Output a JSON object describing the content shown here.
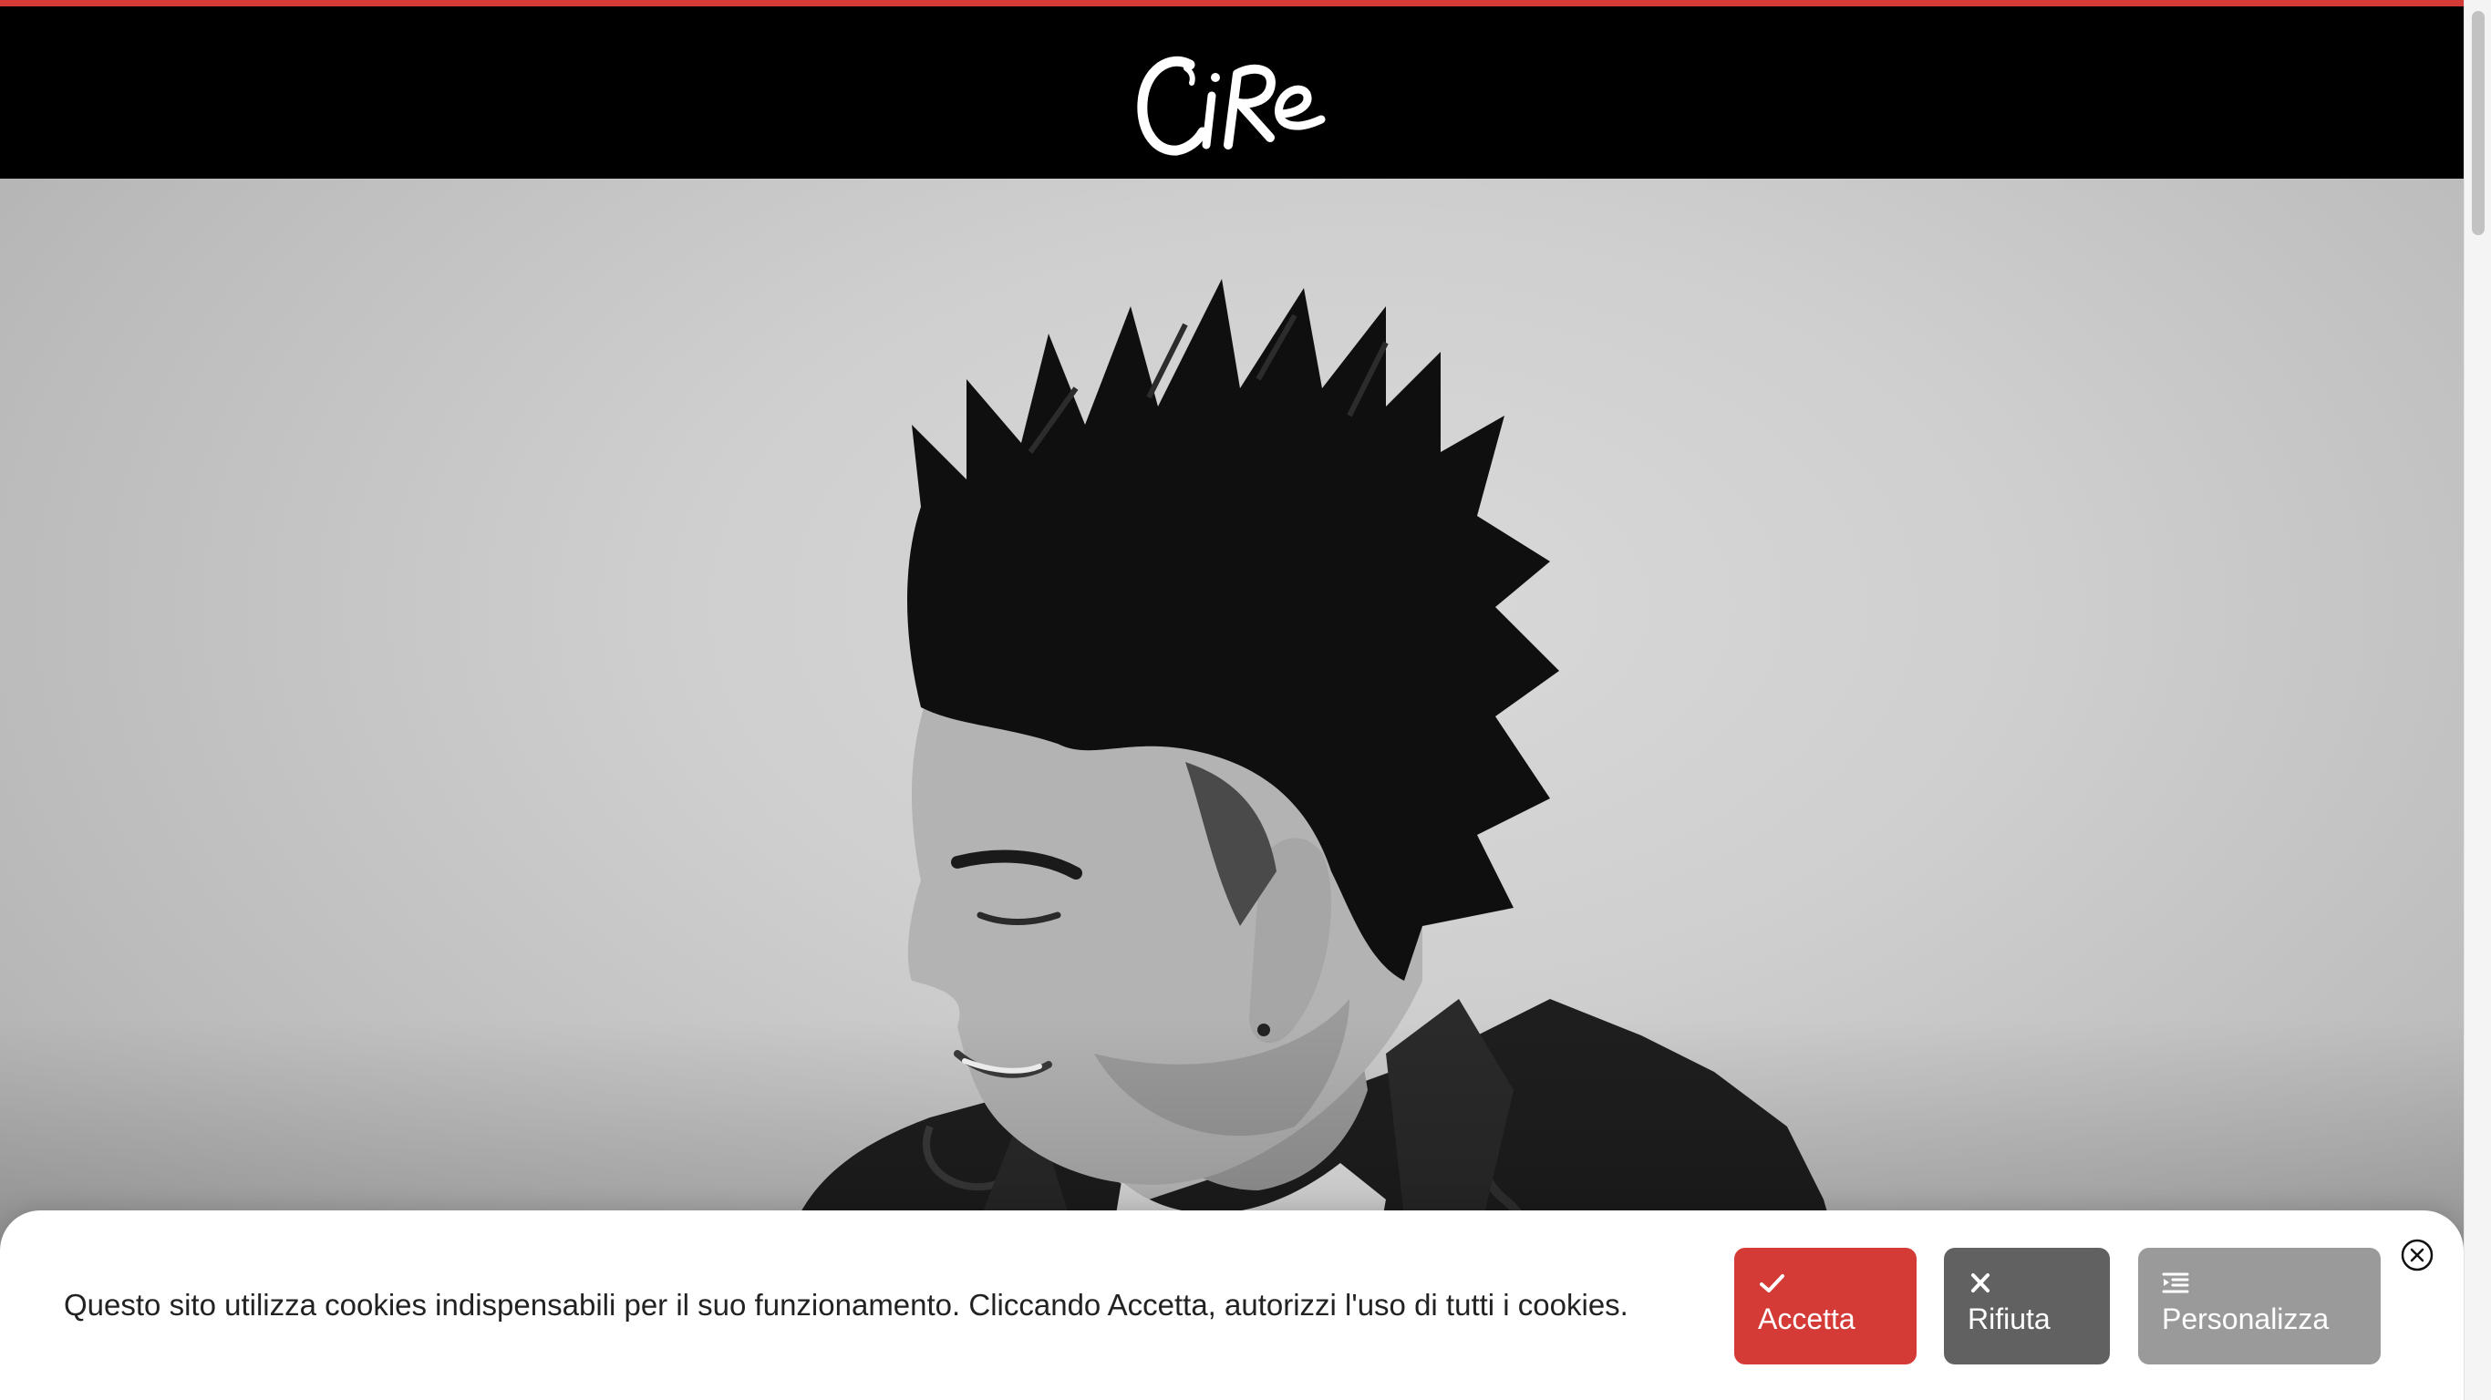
{
  "header": {
    "logo_text": "Cire",
    "accent_color": "#d43a36",
    "background_color": "#000000"
  },
  "hero": {
    "image": "black-and-white portrait of a smiling man with spiky quiff hairstyle wearing a distressed denim jacket"
  },
  "cookie_banner": {
    "message": "Questo sito utilizza cookies indispensabili per il suo funzionamento. Cliccando Accetta, autorizzi l'uso di tutti i cookies.",
    "accept_label": "Accetta",
    "accept_icon": "check-icon",
    "accept_color": "#d43a36",
    "reject_label": "Rifiuta",
    "reject_icon": "x-icon",
    "reject_color": "#616161",
    "customize_label": "Personalizza",
    "customize_icon": "list-settings-icon",
    "customize_color": "#9a9a9a",
    "close_icon": "close-circle-icon"
  }
}
